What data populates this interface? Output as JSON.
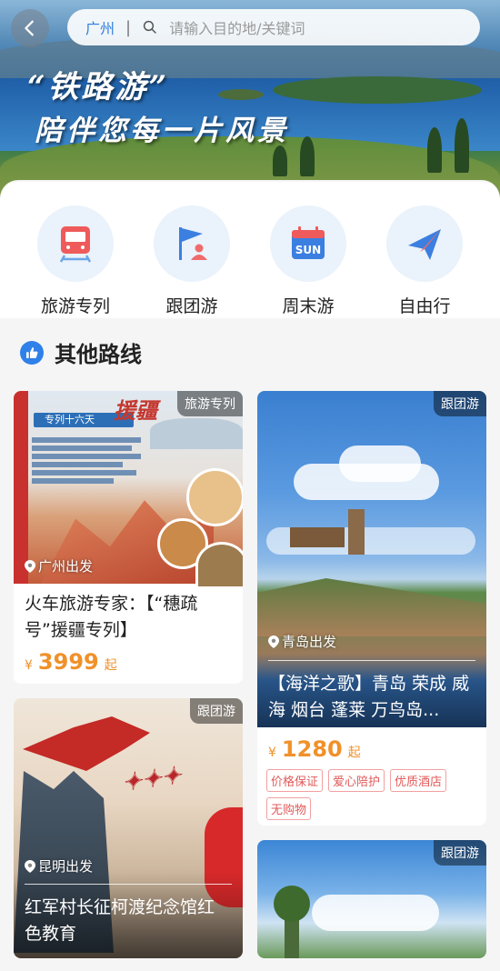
{
  "header": {
    "city": "广州",
    "search_placeholder": "请输入目的地/关键词",
    "banner_title": "“铁路游”",
    "banner_subtitle": "陪伴您每一片风景"
  },
  "categories": [
    {
      "label": "旅游专列",
      "icon": "train-icon"
    },
    {
      "label": "跟团游",
      "icon": "flag-group-icon"
    },
    {
      "label": "周末游",
      "icon": "calendar-sun-icon"
    },
    {
      "label": "自由行",
      "icon": "paper-plane-icon"
    }
  ],
  "section": {
    "title": "其他路线",
    "icon": "thumbs-up-icon"
  },
  "cards": [
    {
      "tag": "旅游专列",
      "depart": "广州出发",
      "title": "火车旅游专家：【“穗疏号”援疆专列】",
      "currency": "¥",
      "price": "3999",
      "price_suffix": "起",
      "poster_text": "援疆",
      "poster_sub": "专列十六天"
    },
    {
      "tag": "跟团游",
      "depart": "青岛出发",
      "title": "【海洋之歌】青岛 荣成 威海 烟台 蓬莱 万鸟岛...",
      "currency": "¥",
      "price": "1280",
      "price_suffix": "起",
      "badges": [
        "价格保证",
        "爱心陪护",
        "优质酒店",
        "无购物"
      ]
    },
    {
      "tag": "跟团游",
      "depart": "昆明出发",
      "title": "红军村长征柯渡纪念馆红色教育"
    },
    {
      "tag": "跟团游"
    }
  ],
  "colors": {
    "accent": "#2f7ee0",
    "price": "#f0912a",
    "badge": "#e25a5a"
  }
}
